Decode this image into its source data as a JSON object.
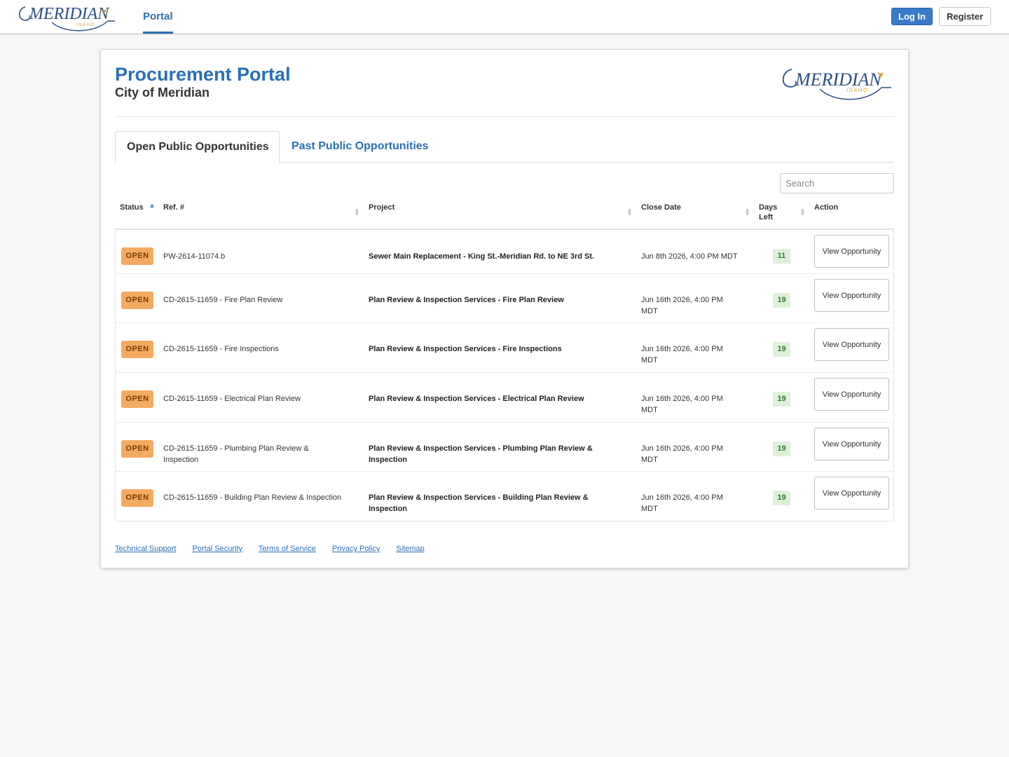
{
  "nav": {
    "logo_text": "MERIDIAN",
    "logo_sub": "IDAHO",
    "portal_link": "Portal",
    "login": "Log In",
    "register": "Register"
  },
  "header": {
    "title": "Procurement Portal",
    "subtitle": "City of Meridian"
  },
  "tabs": {
    "open": "Open Public Opportunities",
    "past": "Past Public Opportunities"
  },
  "search": {
    "placeholder": "Search"
  },
  "table": {
    "columns": {
      "status": "Status",
      "ref": "Ref. #",
      "project": "Project",
      "close_date": "Close Date",
      "days_left_1": "Days",
      "days_left_2": "Left",
      "action": "Action"
    },
    "rows": [
      {
        "status": "OPEN",
        "ref": "PW-2614-11074.b",
        "project": "Sewer Main Replacement - King St.-Meridian Rd. to NE 3rd St.",
        "close_date": "Jun 8th 2026, 4:00 PM MDT",
        "days_left": "11",
        "action": "View Opportunity"
      },
      {
        "status": "OPEN",
        "ref": "CD-2615-11659 - Fire Plan Review",
        "project": "Plan Review & Inspection Services - Fire Plan Review",
        "close_date": "Jun 16th 2026, 4:00 PM MDT",
        "days_left": "19",
        "action": "View Opportunity"
      },
      {
        "status": "OPEN",
        "ref": "CD-2615-11659 - Fire Inspections",
        "project": "Plan Review & Inspection Services - Fire Inspections",
        "close_date": "Jun 16th 2026, 4:00 PM MDT",
        "days_left": "19",
        "action": "View Opportunity"
      },
      {
        "status": "OPEN",
        "ref": "CD-2615-11659 - Electrical Plan Review",
        "project": "Plan Review & Inspection Services - Electrical Plan Review",
        "close_date": "Jun 16th 2026, 4:00 PM MDT",
        "days_left": "19",
        "action": "View Opportunity"
      },
      {
        "status": "OPEN",
        "ref": "CD-2615-11659 - Plumbing Plan Review & Inspection",
        "project": "Plan Review & Inspection Services - Plumbing Plan Review & Inspection",
        "close_date": "Jun 16th 2026, 4:00 PM MDT",
        "days_left": "19",
        "action": "View Opportunity"
      },
      {
        "status": "OPEN",
        "ref": "CD-2615-11659 - Building Plan Review & Inspection",
        "project": "Plan Review & Inspection Services - Building Plan Review & Inspection",
        "close_date": "Jun 16th 2026, 4:00 PM MDT",
        "days_left": "19",
        "action": "View Opportunity"
      }
    ]
  },
  "footer": {
    "links": [
      "Technical Support",
      "Portal Security",
      "Terms of Service",
      "Privacy Policy",
      "Sitemap"
    ]
  },
  "colors": {
    "brand_blue": "#2a6fb5",
    "status_open": "#f3ab62",
    "days_badge": "#def0da",
    "logo_gold": "#d9a21b"
  }
}
